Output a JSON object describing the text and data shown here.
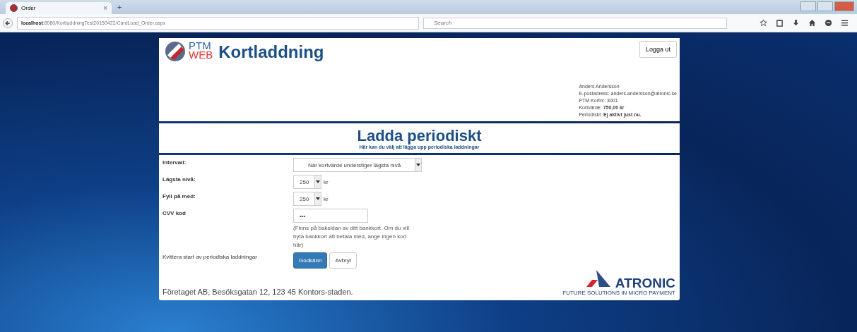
{
  "browser": {
    "tab": {
      "title": "Order",
      "close": "×"
    },
    "new_tab": "+",
    "url": "**localhost**:8080/KortladdningTest20150422/CardLoad_Order.aspx",
    "search": {
      "placeholder": "Search"
    }
  },
  "header": {
    "logo_top": "PTM",
    "logo_bottom": "WEB",
    "title": "Kortladdning",
    "logout": "Logga ut",
    "user_info": [
      "Anders Andersson",
      "E-postadress: anders.andersson@atronic.se",
      "PTM Kortnr: 3001",
      "Kortvärde: **750,00 kr**",
      "Periodiskt: **Ej aktivt just nu.**"
    ]
  },
  "banner": {
    "title": "Ladda periodiskt",
    "subtitle": "Här kan du välj att lägga upp periodiska laddningar"
  },
  "form": {
    "rows": [
      {
        "kind": "select",
        "label": "Intervall:",
        "value": "När kortvärde understiger lägsta nivå"
      },
      {
        "kind": "amount",
        "label": "Lägsta nivå:",
        "value": "250",
        "unit": "kr"
      },
      {
        "kind": "amount",
        "label": "Fyll på med:",
        "value": "250",
        "unit": "kr"
      },
      {
        "kind": "password",
        "label": "CVV kod",
        "value": "•••",
        "hint": "(Finns på baksidan av ditt bankkort. Om du vill byta bankkort att betala med, ange ingen kod här)"
      }
    ],
    "confirm_label": "Kvittera start av periodiska laddningar",
    "buttons": [
      "Godkänn",
      "Avbryt"
    ]
  },
  "footer": {
    "address": "Företaget AB, Besöksgatan 12, 123 45 Kontors-staden.",
    "brand": "ATRONIC",
    "tagline": "FUTURE SOLUTIONS IN MICRO PAYMENT"
  }
}
